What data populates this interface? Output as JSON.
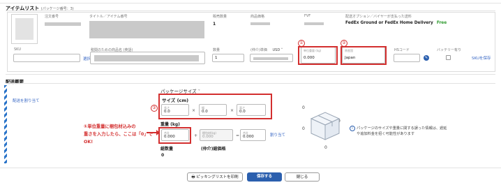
{
  "items_section": {
    "title": "アイテムリスト",
    "subtitle": "(パッケージ番号：3)",
    "headers": {
      "order_no": "注文番号",
      "title_item_no": "タイトル／アイテム番号",
      "sold_qty": "販売数量",
      "price": "商品価格",
      "fvf": "FVF",
      "shipping_option": "配送オプション／バイヤーが支払った送料"
    },
    "sold_qty_value": "1",
    "shipping_option_value": "FedEx Ground or FedEx Home Delivery",
    "shipping_free": "Free",
    "fields": {
      "sku_label": "SKU",
      "customs_label": "税関のための商品名 (英語)",
      "select_link": "選択",
      "quantity_label": "数量",
      "quantity_value": "1",
      "used_price_label": "(仲介)単価",
      "currency": "USD",
      "unit_weight_label": "単位重量 (kg)",
      "unit_weight_value": "0.000",
      "origin_label": "原産国",
      "origin_value": "Japan",
      "hs_label": "HSコード",
      "battery_label": "バッテリー有り",
      "sku_save_link": "SKUを保存"
    }
  },
  "annotations": {
    "one": "①",
    "two": "②",
    "three": "③",
    "note_line1": "①単位重量に梱包材込みの",
    "note_line2": "重さを入力したら、ここは「0」で",
    "note_line3": "OK!"
  },
  "shipping_section": {
    "title": "配送概要",
    "assign_link": "配送を割り当て",
    "package_size_label": "パッケージサイズ",
    "size_label": "サイズ (cm)",
    "length_label": "長さ",
    "length_value": "0.0",
    "width_label": "幅",
    "width_value": "0.0",
    "height_label": "高さ",
    "height_value": "0.0",
    "times": "×",
    "weight_label": "重量 (kg)",
    "weight_value": "0.000",
    "plus": "+",
    "equals": "=",
    "packing_label": "梱包材(kg)",
    "packing_value": "0.000",
    "total_label": "合計",
    "total_value": "0.000",
    "reassign_link": "割り当て",
    "total_qty_label": "総数量",
    "total_qty_value": "0",
    "used_total_label": "(仲介)総価格",
    "zero_a": "0",
    "zero_b": "0",
    "zero_c": "0",
    "zero_d": "0",
    "info_text_1": "パッケージのサイズや重量に関する誤った情報は、遅延",
    "info_text_2": "や追加料金を招く可能性があります"
  },
  "footer": {
    "print_label": "ピッキングリストを印刷",
    "save_label": "保存する",
    "close_label": "閉じる"
  }
}
